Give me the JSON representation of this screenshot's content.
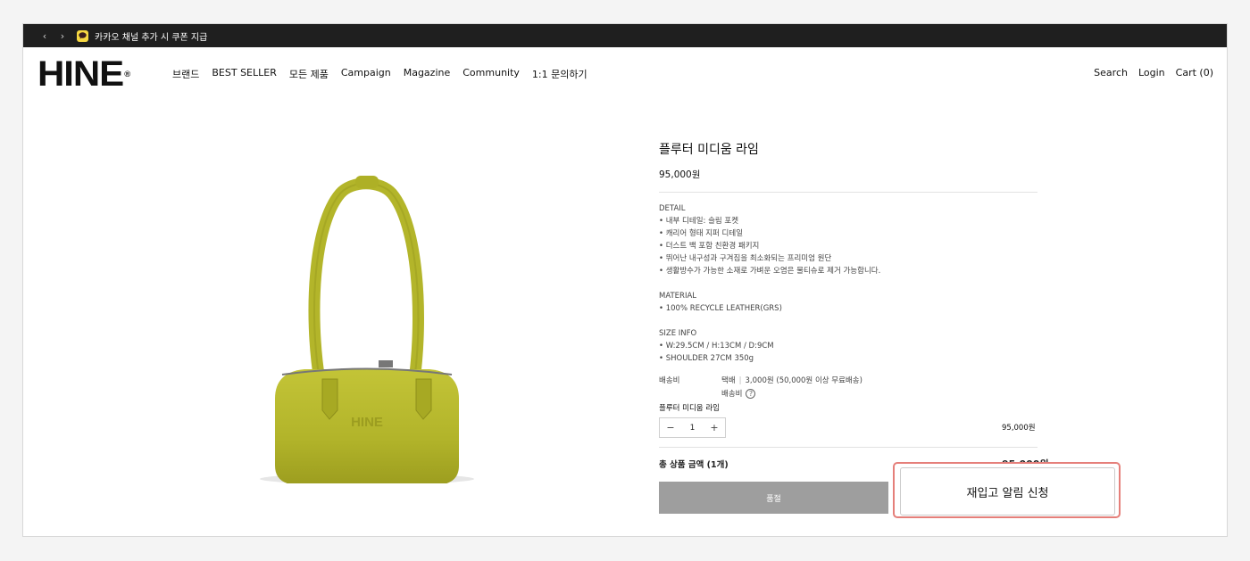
{
  "topbar": {
    "prev_label": "‹",
    "next_label": "›",
    "kakao_icon": "kakao-talk-icon",
    "notice": "카카오 채널 추가 시 쿠폰 지급"
  },
  "header": {
    "logo": "HINE",
    "logo_mark": "®",
    "nav": [
      "브랜드",
      "BEST SELLER",
      "모든 제품",
      "Campaign",
      "Magazine",
      "Community",
      "1:1 문의하기"
    ],
    "util": {
      "search": "Search",
      "login": "Login",
      "cart": "Cart (0)"
    }
  },
  "product": {
    "image_icon": "handbag-product-image",
    "image_color": "#b3b52a",
    "title": "플루터 미디움 라임",
    "price": "95,000원",
    "detail_head": "DETAIL",
    "details": [
      "• 내부 디테일: 슬림 포켓",
      "• 캐리어 형태 지퍼 디테일",
      "• 더스트 백 포함 친환경 패키지",
      "• 뛰어난 내구성과 구겨짐을 최소화되는 프리미엄 원단",
      "• 생활방수가 가능한 소재로 가벼운 오염은 물티슈로 제거 가능합니다."
    ],
    "material_head": "MATERIAL",
    "material": [
      "• 100% RECYCLE LEATHER(GRS)"
    ],
    "size_head": "SIZE INFO",
    "size": [
      "• W:29.5CM / H:13CM / D:9CM",
      "• SHOULDER 27CM 350g"
    ]
  },
  "shipping": {
    "label": "배송비",
    "method": "택배",
    "fee": "3,000원 (50,000원 이상 무료배송)",
    "fee_label": "배송비",
    "help_icon": "question-circle-icon"
  },
  "option": {
    "name": "플루터 미디움 라임",
    "minus": "−",
    "quantity": "1",
    "plus": "+",
    "price": "95,000원"
  },
  "total": {
    "label": "총 상품 금액 (1개)",
    "value": "95,000원"
  },
  "buttons": {
    "soldout": "품절",
    "restock": "재입고 알림 신청"
  },
  "colors": {
    "topbar_bg": "#1f1f1f",
    "soldout_bg": "#9e9e9e",
    "highlight_border": "#e57f7a",
    "kakao_yellow": "#f7d842"
  }
}
